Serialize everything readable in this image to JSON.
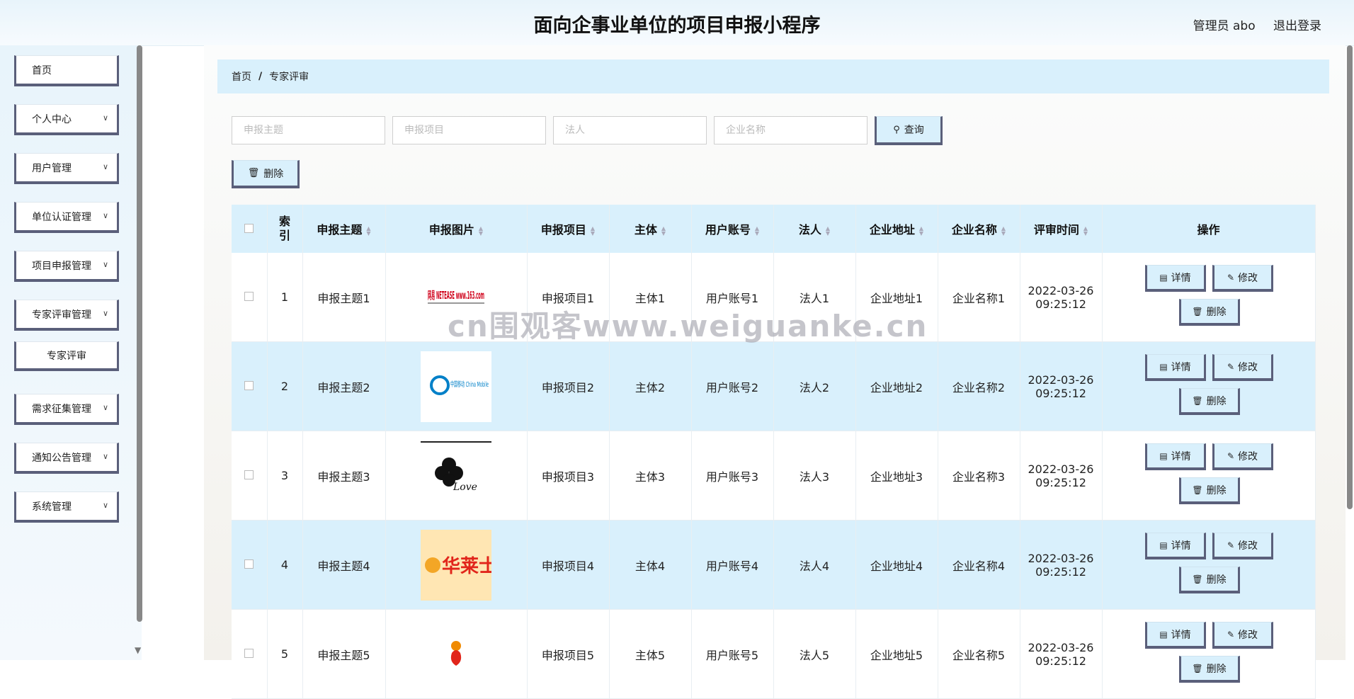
{
  "header": {
    "title": "面向企事业单位的项目申报小程序",
    "user": "管理员 abo",
    "logout": "退出登录"
  },
  "sidebar": {
    "items": [
      {
        "label": "首页",
        "expandable": false
      },
      {
        "label": "个人中心",
        "expandable": true
      },
      {
        "label": "用户管理",
        "expandable": true
      },
      {
        "label": "单位认证管理",
        "expandable": true
      },
      {
        "label": "项目申报管理",
        "expandable": true
      },
      {
        "label": "专家评审管理",
        "expandable": true
      },
      {
        "label": "需求征集管理",
        "expandable": true
      },
      {
        "label": "通知公告管理",
        "expandable": true
      },
      {
        "label": "系统管理",
        "expandable": true
      }
    ],
    "submenu": {
      "label": "专家评审"
    }
  },
  "breadcrumb": {
    "home": "首页",
    "sep": "/",
    "current": "专家评审"
  },
  "search": {
    "subject_placeholder": "申报主题",
    "project_placeholder": "申报项目",
    "legal_placeholder": "法人",
    "company_placeholder": "企业名称",
    "query_label": "查询"
  },
  "toolbar": {
    "delete_label": "删除"
  },
  "table": {
    "columns": [
      "索引",
      "申报主题",
      "申报图片",
      "申报项目",
      "主体",
      "用户账号",
      "法人",
      "企业地址",
      "企业名称",
      "评审时间",
      "操作"
    ],
    "rows": [
      {
        "index": "1",
        "subject": "申报主题1",
        "image": "网易 NETEASE www.163.com",
        "project": "申报项目1",
        "body": "主体1",
        "account": "用户账号1",
        "legal": "法人1",
        "address": "企业地址1",
        "company": "企业名称1",
        "date": "2022-03-26",
        "time": "09:25:12"
      },
      {
        "index": "2",
        "subject": "申报主题2",
        "image": "中国移动 China Mobile",
        "project": "申报项目2",
        "body": "主体2",
        "account": "用户账号2",
        "legal": "法人2",
        "address": "企业地址2",
        "company": "企业名称2",
        "date": "2022-03-26",
        "time": "09:25:12"
      },
      {
        "index": "3",
        "subject": "申报主题3",
        "image": "Love",
        "project": "申报项目3",
        "body": "主体3",
        "account": "用户账号3",
        "legal": "法人3",
        "address": "企业地址3",
        "company": "企业名称3",
        "date": "2022-03-26",
        "time": "09:25:12"
      },
      {
        "index": "4",
        "subject": "申报主题4",
        "image": "华莱士",
        "project": "申报项目4",
        "body": "主体4",
        "account": "用户账号4",
        "legal": "法人4",
        "address": "企业地址4",
        "company": "企业名称4",
        "date": "2022-03-26",
        "time": "09:25:12"
      },
      {
        "index": "5",
        "subject": "申报主题5",
        "image": "",
        "project": "申报项目5",
        "body": "主体5",
        "account": "用户账号5",
        "legal": "法人5",
        "address": "企业地址5",
        "company": "企业名称5",
        "date": "2022-03-26",
        "time": "09:25:12"
      }
    ],
    "ops": {
      "detail": "详情",
      "edit": "修改",
      "delete": "删除"
    }
  },
  "watermark": "cn围观客www.weiguanke.cn",
  "colors": {
    "accent_bg": "#d9f0fc",
    "button_border": "#5a5f7a",
    "logo_red": "#d0021b",
    "china_mobile_blue": "#0080c8",
    "wallace_red": "#e1251b",
    "wallace_bg": "#ffe6b3"
  }
}
